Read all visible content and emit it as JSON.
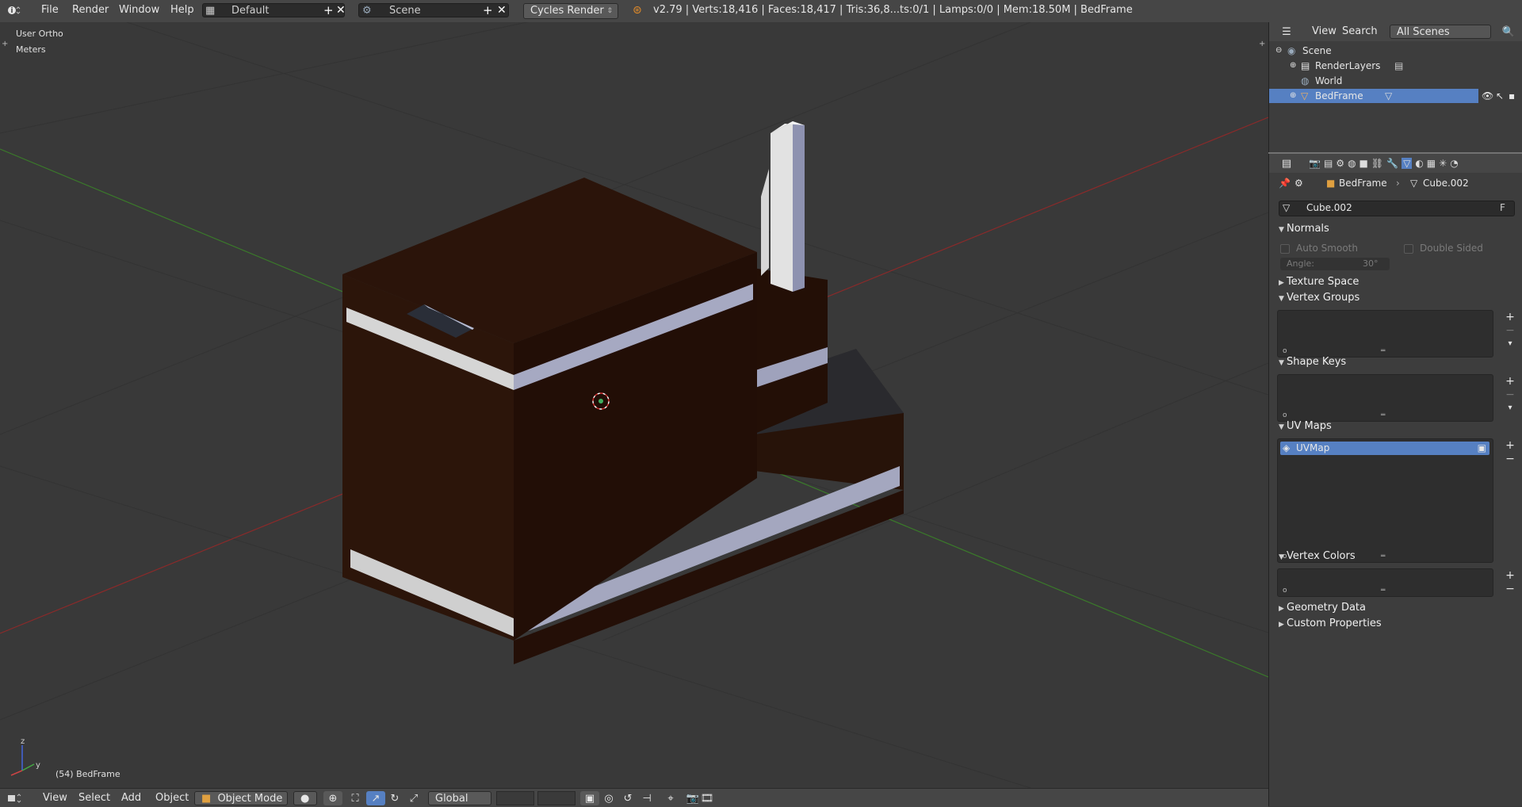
{
  "topbar": {
    "menu": [
      "File",
      "Render",
      "Window",
      "Help"
    ],
    "screen_layout": "Default",
    "scene": "Scene",
    "render_engine": "Cycles Render",
    "stats": "v2.79 | Verts:18,416 | Faces:18,417 | Tris:36,8...ts:0/1 | Lamps:0/0 | Mem:18.50M | BedFrame"
  },
  "viewport": {
    "view_label": "User Ortho",
    "units_label": "Meters",
    "object_info": "(54) BedFrame",
    "axis_labels": {
      "z": "z",
      "y": "y"
    }
  },
  "bottombar": {
    "menu": [
      "View",
      "Select",
      "Add",
      "Object"
    ],
    "mode": "Object Mode",
    "orientation": "Global"
  },
  "outliner": {
    "menu": [
      "View",
      "Search"
    ],
    "scene_filter": "All Scenes",
    "tree": [
      {
        "label": "Scene",
        "icon": "scene-icon"
      },
      {
        "label": "RenderLayers",
        "icon": "render-layers-icon"
      },
      {
        "label": "World",
        "icon": "world-icon"
      },
      {
        "label": "BedFrame",
        "icon": "mesh-object-icon",
        "selected": true
      }
    ]
  },
  "properties": {
    "breadcrumb": {
      "object": "BedFrame",
      "mesh": "Cube.002"
    },
    "datablock_name": "Cube.002",
    "datablock_fake_user": "F",
    "panels": {
      "normals": "Normals",
      "auto_smooth": "Auto Smooth",
      "double_sided": "Double Sided",
      "angle_label": "Angle:",
      "angle_value": "30°",
      "texture_space": "Texture Space",
      "vertex_groups": "Vertex Groups",
      "shape_keys": "Shape Keys",
      "uv_maps": "UV Maps",
      "uv_map_item": "UVMap",
      "vertex_colors": "Vertex Colors",
      "geometry_data": "Geometry Data",
      "custom_properties": "Custom Properties"
    }
  },
  "colors": {
    "header": "#464646",
    "viewport_bg": "#393939",
    "selection": "#5680c2",
    "wood_dark": "#2a140a",
    "stripe": "#a0a4bd"
  }
}
